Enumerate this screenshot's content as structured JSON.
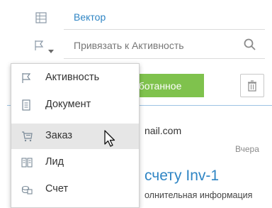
{
  "form": {
    "vector_link": "Вектор",
    "bind_placeholder": "Привязать к Активность",
    "processed_button": "аботанное",
    "icons": {
      "grid": "grid-icon",
      "flag": "flag-icon",
      "dropdown": "chevron-down-icon",
      "search": "search-icon",
      "trash": "trash-icon"
    }
  },
  "background": {
    "email_fragment": "nail.com",
    "date": "Вчера",
    "title_fragment": "счету Inv-1",
    "extra_fragment": "олнительная информация"
  },
  "menu": {
    "items": [
      {
        "label": "Активность",
        "icon": "flag-icon"
      },
      {
        "label": "Документ",
        "icon": "document-icon"
      },
      {
        "label": "Заказ",
        "icon": "cart-icon",
        "highlighted": true
      },
      {
        "label": "Лид",
        "icon": "lead-icon"
      },
      {
        "label": "Счет",
        "icon": "invoice-icon"
      }
    ]
  },
  "colors": {
    "link": "#2f85c4",
    "accent_green": "#7fc24d",
    "menu_highlight": "#e6e6e6"
  }
}
